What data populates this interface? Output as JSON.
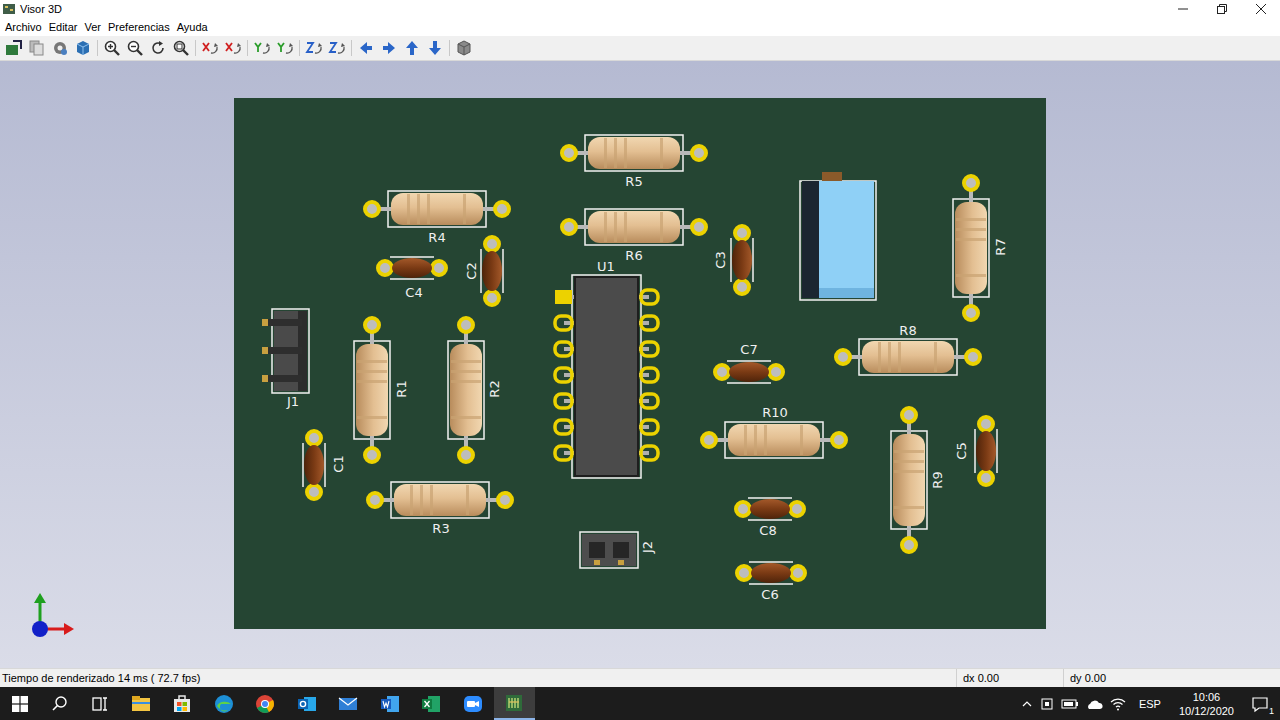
{
  "window": {
    "title": "Visor 3D"
  },
  "menu": [
    "Archivo",
    "Editar",
    "Ver",
    "Preferencias",
    "Ayuda"
  ],
  "board": {
    "components": [
      {
        "ref": "R5",
        "kind": "resistor"
      },
      {
        "ref": "R4",
        "kind": "resistor"
      },
      {
        "ref": "R6",
        "kind": "resistor"
      },
      {
        "ref": "C4",
        "kind": "capacitor"
      },
      {
        "ref": "C2",
        "kind": "capacitor"
      },
      {
        "ref": "U1",
        "kind": "ic"
      },
      {
        "ref": "C3",
        "kind": "capacitor"
      },
      {
        "ref": "",
        "kind": "trimpot"
      },
      {
        "ref": "R7",
        "kind": "resistor"
      },
      {
        "ref": "J1",
        "kind": "header3"
      },
      {
        "ref": "R1",
        "kind": "resistor"
      },
      {
        "ref": "R2",
        "kind": "resistor"
      },
      {
        "ref": "R8",
        "kind": "resistor"
      },
      {
        "ref": "C7",
        "kind": "capacitor"
      },
      {
        "ref": "R10",
        "kind": "resistor"
      },
      {
        "ref": "C1",
        "kind": "capacitor"
      },
      {
        "ref": "R3",
        "kind": "resistor"
      },
      {
        "ref": "C8",
        "kind": "capacitor"
      },
      {
        "ref": "J2",
        "kind": "header2"
      },
      {
        "ref": "R9",
        "kind": "resistor"
      },
      {
        "ref": "C5",
        "kind": "capacitor"
      },
      {
        "ref": "C6",
        "kind": "capacitor"
      }
    ]
  },
  "status_bar": {
    "render": "Tiempo de renderizado 14 ms ( 72.7 fps)",
    "dx": "dx 0.00",
    "dy": "dy 0.00"
  },
  "taskbar": {
    "apps": [
      {
        "active": false
      },
      {
        "active": false
      },
      {
        "active": false
      },
      {
        "active": false
      },
      {
        "active": false
      },
      {
        "active": false
      },
      {
        "active": false
      },
      {
        "active": false
      },
      {
        "active": false
      },
      {
        "active": true
      }
    ],
    "language": "ESP",
    "time": "10:06",
    "date": "10/12/2020",
    "notifications": "1"
  }
}
